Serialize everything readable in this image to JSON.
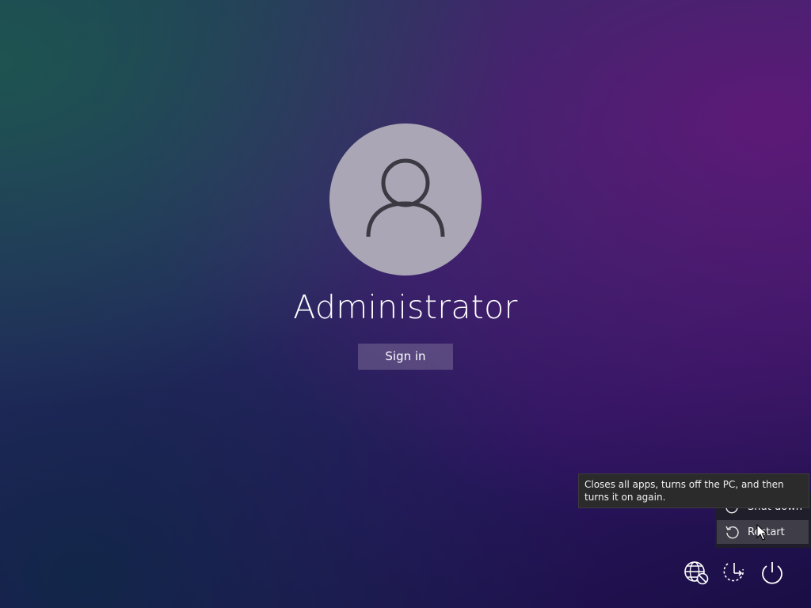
{
  "user": {
    "name": "Administrator",
    "avatar_icon": "user-silhouette-icon"
  },
  "sign_in": {
    "label": "Sign in"
  },
  "power_menu": {
    "items": [
      {
        "label": "Shut down",
        "icon": "power-icon"
      },
      {
        "label": "Restart",
        "icon": "restart-icon"
      }
    ],
    "highlighted": "Restart"
  },
  "tooltip": {
    "text": "Closes all apps, turns off the PC, and then turns it on again."
  },
  "bottom_bar": {
    "icons": [
      "network-globe-icon",
      "accessibility-icon",
      "power-icon"
    ]
  },
  "colors": {
    "avatar_bg": "#aba6b5",
    "avatar_glyph": "#3b3942",
    "signin_bg": "#6e6590",
    "menu_bg": "#202026",
    "tooltip_bg": "#2b2b2b"
  }
}
